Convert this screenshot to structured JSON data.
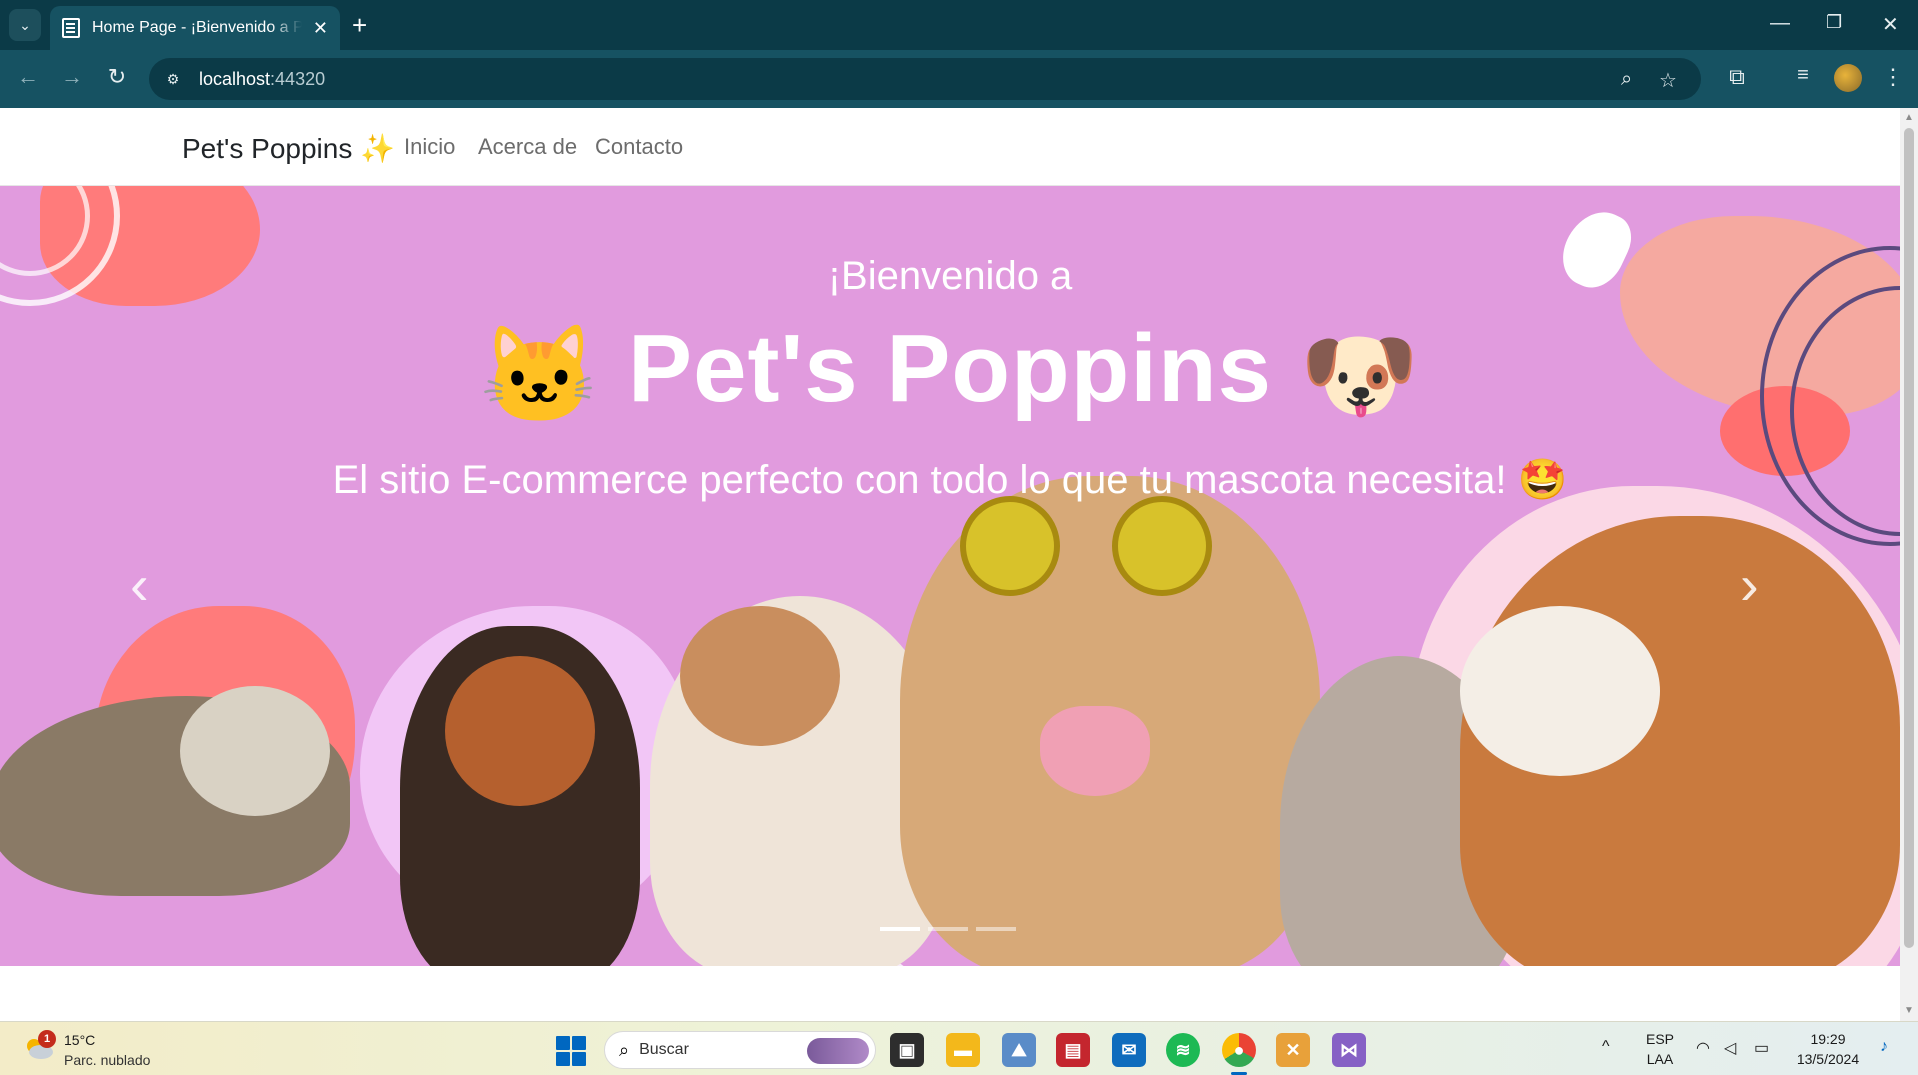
{
  "browser": {
    "tab_title": "Home Page - ¡Bienvenido a Pet's Poppins",
    "url_host": "localhost",
    "url_port": ":44320",
    "accent": "#165262",
    "tabbar_bg": "#0b3a47"
  },
  "navbar": {
    "brand": "Pet's Poppins ✨",
    "links": [
      "Inicio",
      "Acerca de",
      "Contacto"
    ]
  },
  "hero": {
    "greeting": "¡Bienvenido a",
    "title": "Pet's Poppins",
    "title_left_emoji": "🐱",
    "title_right_emoji": "🐶",
    "subtitle": "El sitio E-commerce perfecto con todo lo que tu mascota necesita!",
    "subtitle_emoji": "🤩",
    "background": "#e19bde",
    "slides": 3,
    "active_slide": 1
  },
  "taskbar": {
    "weather_temp": "15°C",
    "weather_desc": "Parc. nublado",
    "weather_badge": "1",
    "search_label": "Buscar",
    "language_top": "ESP",
    "language_bottom": "LAA",
    "time": "19:29",
    "date": "13/5/2024"
  }
}
